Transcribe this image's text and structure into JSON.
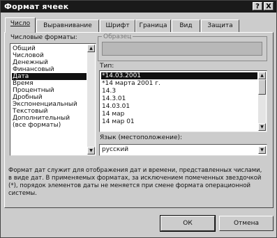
{
  "window": {
    "title": "Формат ячеек",
    "help_label": "?",
    "close_label": "X"
  },
  "tabs": [
    {
      "label": "Число",
      "active": true
    },
    {
      "label": "Выравнивание",
      "active": false
    },
    {
      "label": "Шрифт",
      "active": false
    },
    {
      "label": "Граница",
      "active": false
    },
    {
      "label": "Вид",
      "active": false
    },
    {
      "label": "Защита",
      "active": false
    }
  ],
  "formats": {
    "label": "Числовые форматы:",
    "items": [
      "Общий",
      "Числовой",
      "Денежный",
      "Финансовый",
      "Дата",
      "Время",
      "Процентный",
      "Дробный",
      "Экспоненциальный",
      "Текстовый",
      "Дополнительный",
      "(все форматы)"
    ],
    "selected_index": 4
  },
  "sample": {
    "label": "Образец",
    "value": ""
  },
  "type": {
    "label": "Тип:",
    "items": [
      "*14.03.2001",
      "*14 марта 2001 г.",
      "14.3",
      "14.3.01",
      "14.03.01",
      "14 мар",
      "14 мар 01"
    ],
    "selected_index": 0
  },
  "language": {
    "label": "Язык (местоположение):",
    "value": "русский"
  },
  "description": "Формат дат служит для отображения дат и времени, представленных числами, в виде дат. В применяемых форматах, за исключением помеченных звездочкой (*), порядок элементов даты не меняется при смене формата операционной системы.",
  "buttons": {
    "ok": "ОК",
    "cancel": "Отмена"
  },
  "icons": {
    "scroll_up": "up-arrow-icon",
    "scroll_down": "down-arrow-icon",
    "dropdown": "chevron-down-icon"
  }
}
